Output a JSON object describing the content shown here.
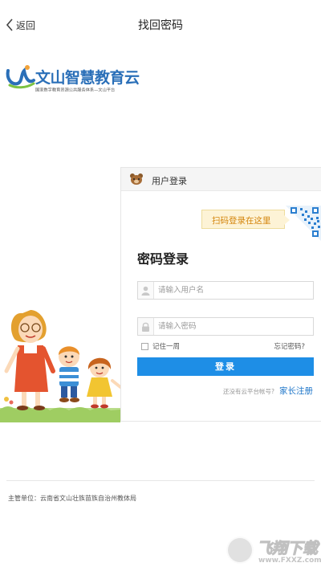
{
  "nav": {
    "back_label": "返回",
    "title": "找回密码"
  },
  "logo": {
    "name": "文山智慧教育云",
    "subtitle": "国家数字教育资源公共服务体系—文山平台"
  },
  "login_panel": {
    "header_title": "用户登录",
    "qr_tip": "扫码登录在这里",
    "section_title": "密码登录",
    "username_placeholder": "请输入用户名",
    "password_placeholder": "请输入密码",
    "remember_label": "记住一周",
    "forgot_label": "忘记密码?",
    "login_button": "登录",
    "register_question": "还没有云平台帐号?",
    "register_link": "家长注册",
    "colors": {
      "button": "#1e8ee6",
      "link": "#1e76c9",
      "tip_text": "#d4850c"
    }
  },
  "footer": {
    "text": "主管单位：云南省文山壮族苗族自治州教体局"
  },
  "watermark": {
    "title": "飞翔下载",
    "url": "www.FXXZ.com"
  }
}
